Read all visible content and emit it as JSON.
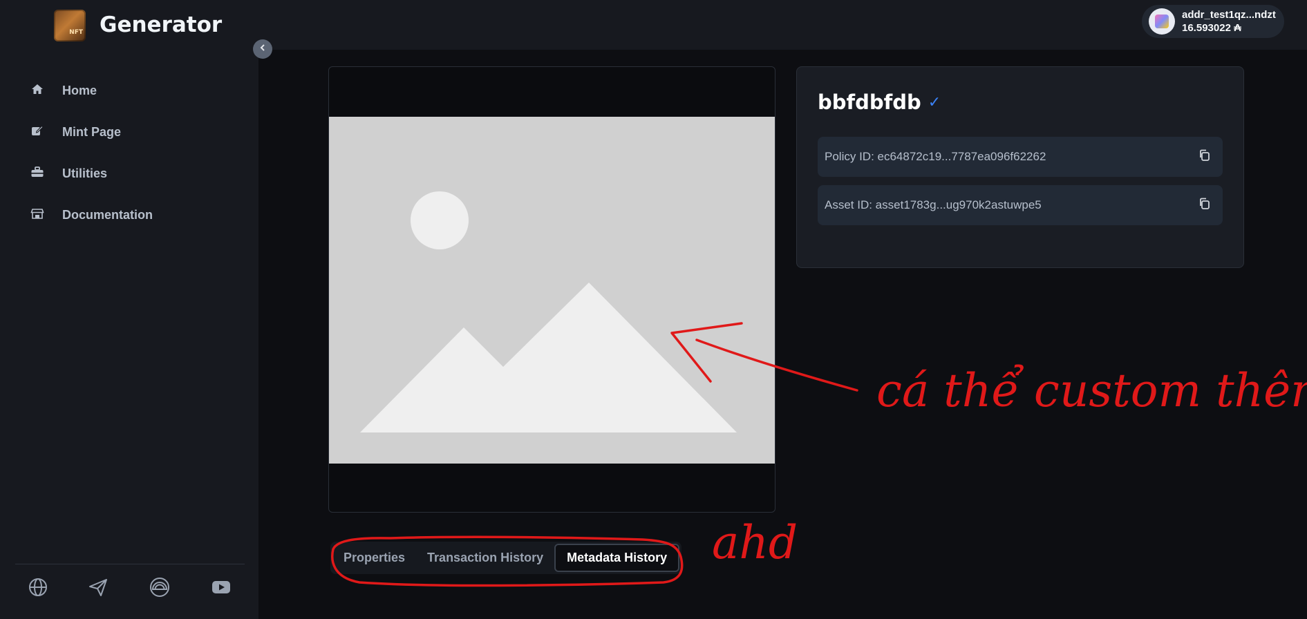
{
  "app": {
    "title": "Generator",
    "logo_text": "NFT"
  },
  "sidebar": {
    "items": [
      {
        "label": "Home",
        "icon": "home-icon"
      },
      {
        "label": "Mint Page",
        "icon": "edit-icon"
      },
      {
        "label": "Utilities",
        "icon": "toolbox-icon"
      },
      {
        "label": "Documentation",
        "icon": "store-icon"
      }
    ],
    "socials": [
      "globe-icon",
      "send-icon",
      "rainbow-icon",
      "youtube-icon"
    ]
  },
  "wallet": {
    "address": "addr_test1qz...ndzt",
    "balance": "16.593022 ₳"
  },
  "asset": {
    "name": "bbfdbfdb",
    "verified_mark": "✓",
    "policy_id": "Policy ID: ec64872c19...7787ea096f62262",
    "asset_id": "Asset ID: asset1783g...ug970k2astuwpe5"
  },
  "tabs": [
    {
      "label": "Properties",
      "active": false
    },
    {
      "label": "Transaction History",
      "active": false
    },
    {
      "label": "Metadata History",
      "active": true
    }
  ],
  "annotations": {
    "note_image": "cá thể custom thêm",
    "note_tabs": "ahd"
  },
  "colors": {
    "accent": "#3b82f6",
    "annotation": "#e01919",
    "background": "#0d0e12",
    "panel": "#17191f"
  }
}
